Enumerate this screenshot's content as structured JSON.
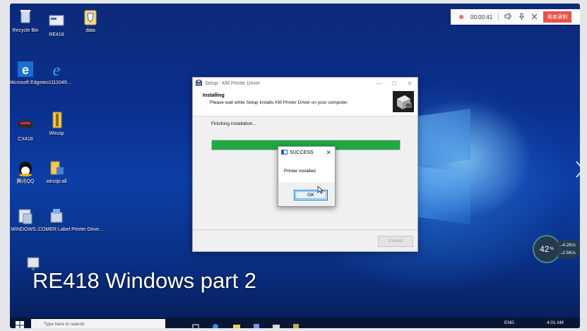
{
  "recorder": {
    "timer": "00:00:41",
    "stop_label": "结束录制"
  },
  "desktop_icons": [
    {
      "label": "Recycle Bin"
    },
    {
      "label": "RE418"
    },
    {
      "label": "data"
    },
    {
      "label": "Microsoft Edge"
    },
    {
      "label": "ieo1111049..."
    },
    {
      "label": "CX418"
    },
    {
      "label": "Winzip"
    },
    {
      "label": "腾讯QQ"
    },
    {
      "label": "winzip-all"
    },
    {
      "label": "WINDOWS..."
    },
    {
      "label": "COMER Label Printer Drive..."
    }
  ],
  "setup_window": {
    "title": "Setup - KM Printer Driver",
    "heading": "Installing",
    "subheading": "Please wait while Setup installs KM Printer Driver on your computer.",
    "status": "Finishing installation...",
    "progress": 1.0,
    "cancel_label": "Cancel",
    "minimize_glyph": "—",
    "maximize_glyph": "☐",
    "close_glyph": "✕"
  },
  "message_box": {
    "title": "SUCCESS",
    "message": "Printer installed",
    "ok_label": "OK",
    "close_glyph": "✕"
  },
  "net_speed": {
    "percent": "42",
    "percent_unit": "%",
    "upload": "4.2K/s",
    "download": "2.5K/s"
  },
  "caption": "RE418 Windows part 2",
  "taskbar": {
    "search_placeholder": "Type here to search",
    "language": "ENG",
    "time": "4:01 AM"
  },
  "colors": {
    "progress": "#21a845",
    "record_stop": "#e9534a",
    "desktop_blue": "#0b3390"
  }
}
